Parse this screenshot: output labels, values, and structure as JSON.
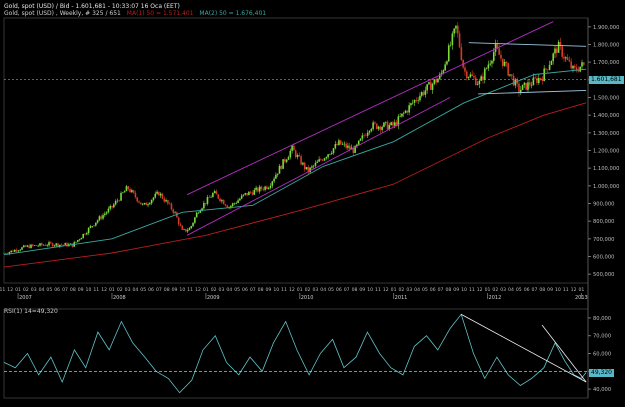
{
  "header": {
    "title": "Gold, spot (USD) / Bid - 1.601,681 - 10:33:07  16 Oca (EET)",
    "study_line_prefix": "Gold, spot (USD) , Weekly, # 325 / 651",
    "ma1_label": "MA(1) 50 = 1.571,401",
    "ma2_label": "MA(2) 50 = 1.676,401"
  },
  "colors": {
    "background": "#000000",
    "up_candle": "#7ddc3c",
    "down_candle": "#d83a2a",
    "ma_short": "#3aa7a0",
    "ma_long": "#b81e1e",
    "channel": "#b32fc2",
    "flag": "#9cc7e0",
    "rsi": "#5fc4c9",
    "price_tag": "#58b8c7"
  },
  "price_axis": {
    "ticks": [
      "1.900,000",
      "1.800,000",
      "1.700,000",
      "1.600,000",
      "1.500,000",
      "1.400,000",
      "1.300,000",
      "1.200,000",
      "1.100,000",
      "1.000,000",
      "900,000",
      "800,000",
      "700,000",
      "600,000",
      "500,000"
    ],
    "current_price_label": "1.601,681"
  },
  "rsi_panel": {
    "label": "RSI(1) 14=49,320",
    "ticks": [
      "80,000",
      "70,000",
      "60,000",
      "50,000",
      "40,000"
    ],
    "current_label": "49,320"
  },
  "time_axis": {
    "month_labels": [
      "11",
      "12",
      "01",
      "02",
      "03",
      "04",
      "05",
      "06",
      "07",
      "08",
      "09",
      "10",
      "11",
      "12",
      "01",
      "02",
      "03",
      "04",
      "05",
      "06",
      "07",
      "08",
      "09",
      "10",
      "11",
      "12",
      "01",
      "02",
      "03",
      "04",
      "05",
      "06",
      "07",
      "08",
      "09",
      "10",
      "11",
      "12",
      "01",
      "02",
      "03",
      "04",
      "05",
      "06",
      "07",
      "08",
      "09",
      "10",
      "11",
      "12",
      "01",
      "02",
      "03",
      "04",
      "05",
      "06",
      "07",
      "08",
      "09",
      "10",
      "11",
      "12",
      "01",
      "02",
      "03",
      "04",
      "05",
      "06",
      "07",
      "08",
      "09",
      "10",
      "11",
      "12",
      "01",
      "02"
    ],
    "year_labels": [
      "2007",
      "2008",
      "2009",
      "2010",
      "2011",
      "2012",
      "2013"
    ]
  },
  "chart_data": [
    {
      "type": "candlestick",
      "title": "Gold, spot (USD) / Bid - 1.601,681 - 10:33:07  16 Oca (EET)",
      "interval": "Weekly",
      "x_range": [
        "2006-11",
        "2013-01"
      ],
      "ylim": [
        450,
        1950
      ],
      "y_ticks": [
        500,
        600,
        700,
        800,
        900,
        1000,
        1100,
        1200,
        1300,
        1400,
        1500,
        1600,
        1700,
        1800,
        1900
      ],
      "close_path": [
        [
          "2006-11",
          615
        ],
        [
          "2007-02",
          655
        ],
        [
          "2007-05",
          670
        ],
        [
          "2007-08",
          665
        ],
        [
          "2007-11",
          800
        ],
        [
          "2008-01",
          880
        ],
        [
          "2008-03",
          990
        ],
        [
          "2008-05",
          885
        ],
        [
          "2008-07",
          960
        ],
        [
          "2008-09",
          850
        ],
        [
          "2008-10",
          740
        ],
        [
          "2008-11",
          760
        ],
        [
          "2008-12",
          860
        ],
        [
          "2009-02",
          960
        ],
        [
          "2009-04",
          880
        ],
        [
          "2009-06",
          950
        ],
        [
          "2009-09",
          1000
        ],
        [
          "2009-12",
          1210
        ],
        [
          "2010-02",
          1080
        ],
        [
          "2010-04",
          1160
        ],
        [
          "2010-06",
          1240
        ],
        [
          "2010-08",
          1200
        ],
        [
          "2010-10",
          1340
        ],
        [
          "2011-01",
          1340
        ],
        [
          "2011-04",
          1500
        ],
        [
          "2011-07",
          1620
        ],
        [
          "2011-09",
          1900
        ],
        [
          "2011-10",
          1650
        ],
        [
          "2011-12",
          1580
        ],
        [
          "2012-02",
          1780
        ],
        [
          "2012-05",
          1540
        ],
        [
          "2012-08",
          1620
        ],
        [
          "2012-10",
          1790
        ],
        [
          "2012-12",
          1650
        ],
        [
          "2013-01",
          1680
        ]
      ],
      "series": [
        {
          "name": "MA(1) 50",
          "values": [
            [
              2006.85,
              610
            ],
            [
              2008.0,
              700
            ],
            [
              2008.75,
              850
            ],
            [
              2009.5,
              890
            ],
            [
              2010.25,
              1110
            ],
            [
              2011.0,
              1250
            ],
            [
              2011.75,
              1470
            ],
            [
              2012.5,
              1630
            ],
            [
              2013.05,
              1660
            ]
          ]
        },
        {
          "name": "MA(2) 50",
          "values": [
            [
              2006.85,
              540
            ],
            [
              2008.0,
              620
            ],
            [
              2009.0,
              720
            ],
            [
              2010.0,
              860
            ],
            [
              2011.0,
              1010
            ],
            [
              2012.0,
              1270
            ],
            [
              2012.6,
              1400
            ],
            [
              2013.05,
              1470
            ]
          ]
        }
      ],
      "annotations": {
        "rising_channel_upper": [
          [
            2008.8,
            950
          ],
          [
            2012.7,
            1930
          ]
        ],
        "rising_channel_lower": [
          [
            2008.8,
            720
          ],
          [
            2011.6,
            1500
          ]
        ],
        "flag_upper": [
          [
            2011.8,
            1810
          ],
          [
            2013.05,
            1790
          ]
        ],
        "flag_lower": [
          [
            2011.9,
            1520
          ],
          [
            2013.05,
            1540
          ]
        ],
        "current_price_line": 1601.681
      }
    },
    {
      "type": "line",
      "title": "RSI(1) 14=49,320",
      "ylim": [
        35,
        85
      ],
      "y_ticks": [
        40,
        50,
        60,
        70,
        80
      ],
      "reference_level": 50,
      "values": [
        [
          2006.85,
          55
        ],
        [
          2006.97,
          52
        ],
        [
          2007.1,
          60
        ],
        [
          2007.22,
          48
        ],
        [
          2007.35,
          58
        ],
        [
          2007.47,
          44
        ],
        [
          2007.6,
          62
        ],
        [
          2007.72,
          52
        ],
        [
          2007.85,
          72
        ],
        [
          2007.97,
          62
        ],
        [
          2008.1,
          78
        ],
        [
          2008.22,
          66
        ],
        [
          2008.35,
          58
        ],
        [
          2008.47,
          50
        ],
        [
          2008.6,
          46
        ],
        [
          2008.72,
          38
        ],
        [
          2008.85,
          45
        ],
        [
          2008.97,
          62
        ],
        [
          2009.1,
          70
        ],
        [
          2009.22,
          55
        ],
        [
          2009.35,
          48
        ],
        [
          2009.47,
          58
        ],
        [
          2009.6,
          50
        ],
        [
          2009.72,
          66
        ],
        [
          2009.85,
          78
        ],
        [
          2009.97,
          62
        ],
        [
          2010.1,
          48
        ],
        [
          2010.22,
          60
        ],
        [
          2010.35,
          68
        ],
        [
          2010.47,
          52
        ],
        [
          2010.6,
          58
        ],
        [
          2010.72,
          72
        ],
        [
          2010.85,
          60
        ],
        [
          2010.97,
          52
        ],
        [
          2011.1,
          48
        ],
        [
          2011.22,
          64
        ],
        [
          2011.35,
          70
        ],
        [
          2011.47,
          62
        ],
        [
          2011.6,
          74
        ],
        [
          2011.72,
          82
        ],
        [
          2011.85,
          60
        ],
        [
          2011.97,
          46
        ],
        [
          2012.1,
          58
        ],
        [
          2012.22,
          48
        ],
        [
          2012.35,
          42
        ],
        [
          2012.47,
          46
        ],
        [
          2012.6,
          52
        ],
        [
          2012.72,
          66
        ],
        [
          2012.82,
          56
        ],
        [
          2012.92,
          48
        ],
        [
          2013.0,
          46
        ],
        [
          2013.05,
          49.32
        ]
      ],
      "annotations": {
        "trendline_1": [
          [
            2011.72,
            82
          ],
          [
            2013.05,
            44
          ]
        ],
        "trendline_2": [
          [
            2012.58,
            76
          ],
          [
            2013.05,
            44
          ]
        ]
      }
    }
  ]
}
